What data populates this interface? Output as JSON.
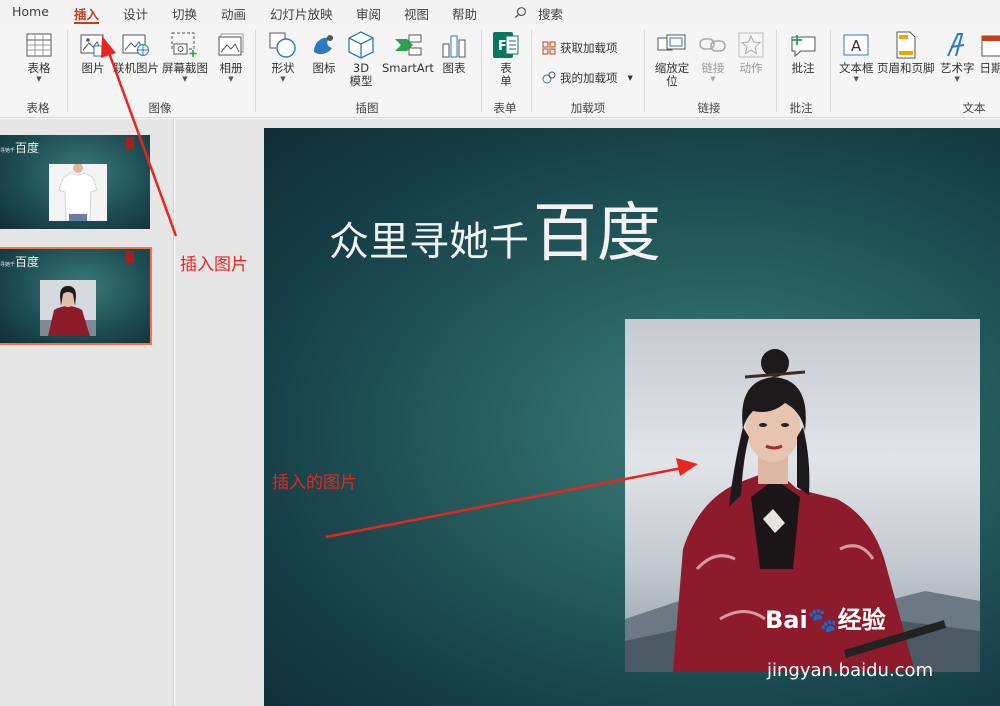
{
  "tabs": [
    "Home",
    "插入",
    "设计",
    "切换",
    "动画",
    "幻灯片放映",
    "审阅",
    "视图",
    "帮助"
  ],
  "active_tab": "插入",
  "search_label": "搜索",
  "ribbon": {
    "groups": {
      "table": "表格",
      "images": "图像",
      "illustrations": "插图",
      "forms": "表单",
      "addins": "加载项",
      "links": "链接",
      "comments": "批注",
      "text": "文本"
    },
    "buttons": {
      "table": "表格",
      "picture": "图片",
      "online_picture": "联机图片",
      "screenshot": "屏幕截图",
      "album": "相册",
      "shapes": "形状",
      "icons": "图标",
      "model3d": "3D 模型",
      "smartart": "SmartArt",
      "chart": "图表",
      "form": "表单",
      "get_addins": "获取加载项",
      "my_addins": "我的加载项",
      "zoom": "缩放定位",
      "link": "链接",
      "action": "动作",
      "comment": "批注",
      "textbox": "文本框",
      "header_footer": "页眉和页脚",
      "wordart": "艺术字",
      "datetime": "日期"
    }
  },
  "thumbnails": [
    {
      "title_small": "寻她千",
      "title_big": "百度"
    },
    {
      "title_small": "寻她千",
      "title_big": "百度"
    }
  ],
  "slide": {
    "title_part1": "众里寻她千",
    "title_part2": "百度"
  },
  "annotations": {
    "insert_picture": "插入图片",
    "inserted_picture": "插入的图片"
  },
  "watermark": {
    "logo_prefix": "Bai",
    "logo_suffix": "经验",
    "url": "jingyan.baidu.com"
  },
  "colors": {
    "accent": "#c43e1c",
    "annotation": "#e8261f",
    "slide_bg": "#28605f"
  }
}
